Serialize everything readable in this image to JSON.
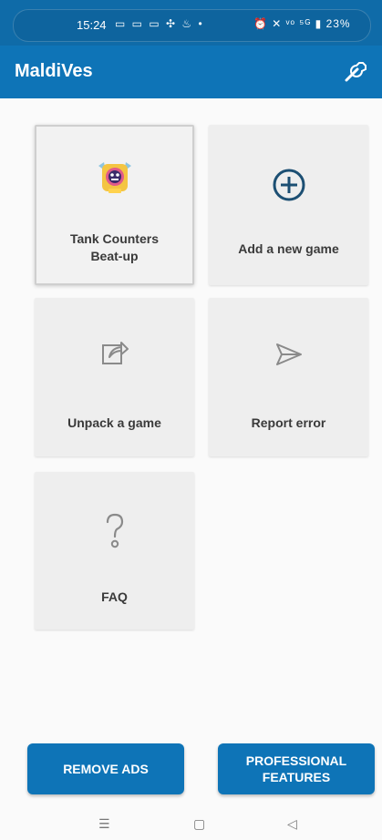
{
  "status": {
    "time": "15:24",
    "notifications": "▭ ▭ ▭ ✣ ♨ •",
    "indicators": "⏰ ✕ ᵛᵒ ⁵ᴳ ▮ 23%"
  },
  "app": {
    "title": "MaldiVes",
    "settings_icon": "wrench-icon"
  },
  "tiles": [
    {
      "label": "Tank Counters Beat-up",
      "icon": "game-badge-icon"
    },
    {
      "label": "Add a new game",
      "icon": "add-circle-icon"
    },
    {
      "label": "Unpack a game",
      "icon": "share-box-icon"
    },
    {
      "label": "Report error",
      "icon": "send-icon"
    },
    {
      "label": "FAQ",
      "icon": "question-icon"
    }
  ],
  "buttons": {
    "remove_ads": "REMOVE ADS",
    "professional": "PROFESSIONAL FEATURES"
  },
  "navbar": {
    "menu": "☰",
    "home": "▢",
    "back": "◁"
  },
  "colors": {
    "primary": "#0e74b7",
    "tile_bg": "#eeeeee"
  }
}
